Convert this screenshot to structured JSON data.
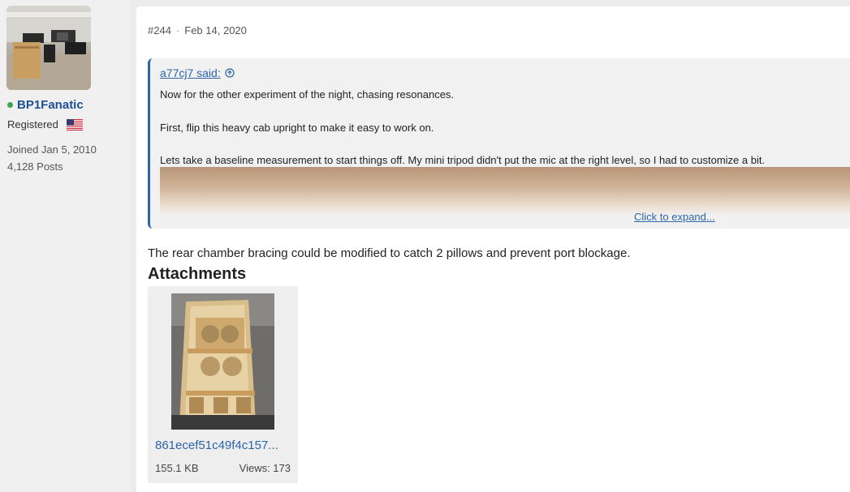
{
  "user": {
    "name": "BP1Fanatic",
    "role": "Registered",
    "joined": "Joined Jan 5, 2010",
    "posts": "4,128 Posts"
  },
  "post": {
    "number": "#244",
    "separator": "·",
    "date": "Feb 14, 2020",
    "quote": {
      "author": "a77cj7 said:",
      "lines": [
        "Now for the other experiment of the night, chasing resonances.",
        "First, flip this heavy cab upright to make it easy to work on.",
        "Lets take a baseline measurement to start things off. My mini tripod didn't put the mic at the right level, so I had to customize a bit."
      ],
      "expand_label": "Click to expand..."
    },
    "body": "The rear chamber bracing could be modified to catch 2 pillows and prevent port blockage.",
    "attachments_title": "Attachments",
    "attachment": {
      "filename": "861ecef51c49f4c157...",
      "size": "155.1 KB",
      "views": "Views: 173"
    }
  },
  "colors": {
    "link": "#2d64a8",
    "username": "#1d4f91",
    "online": "#3fa34d"
  }
}
